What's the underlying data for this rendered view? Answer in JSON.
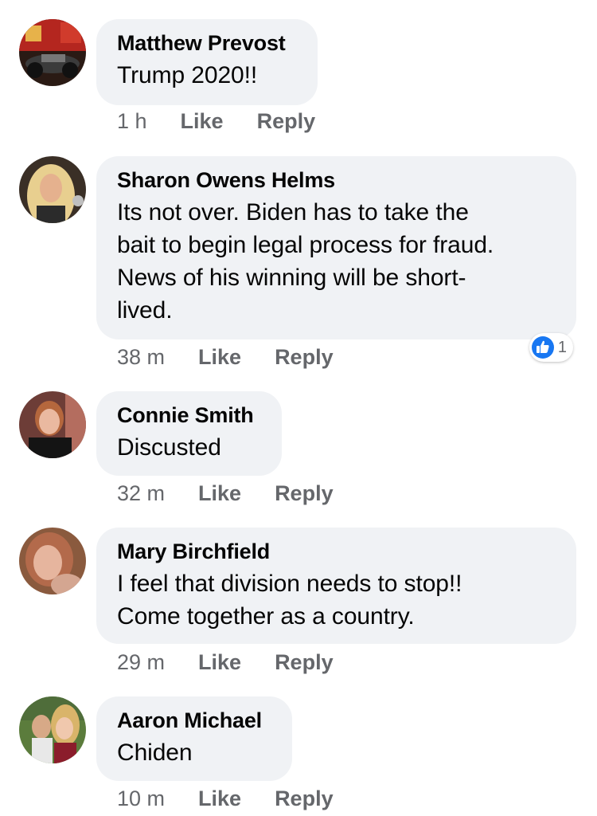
{
  "comments": [
    {
      "author": "Matthew Prevost",
      "text": "Trump 2020!!",
      "time": "1 h",
      "like": "Like",
      "reply": "Reply"
    },
    {
      "author": "Sharon Owens Helms",
      "text_lines": [
        "Its not over. Biden has to take the",
        "bait to begin legal process for fraud.",
        "News of his winning will be short-",
        "lived."
      ],
      "time": "38 m",
      "like": "Like",
      "reply": "Reply",
      "reaction_count": "1"
    },
    {
      "author": "Connie Smith",
      "text": "Discusted",
      "time": "32 m",
      "like": "Like",
      "reply": "Reply"
    },
    {
      "author": "Mary Birchfield",
      "text_lines": [
        "I feel that division needs to stop!!",
        "Come together as a country."
      ],
      "time": "29 m",
      "like": "Like",
      "reply": "Reply"
    },
    {
      "author": "Aaron Michael",
      "text": "Chiden",
      "time": "10 m",
      "like": "Like",
      "reply": "Reply"
    }
  ],
  "colors": {
    "bubble": "#f0f2f5",
    "meta": "#65676b",
    "like_blue": "#1877f2"
  },
  "icons": {
    "reaction": "thumbs-up-icon"
  }
}
